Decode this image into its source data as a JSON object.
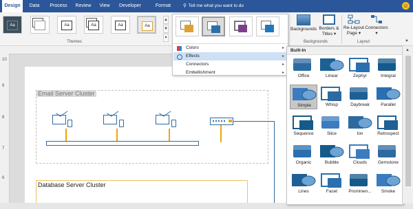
{
  "tabs": [
    "Design",
    "Data",
    "Process",
    "Review",
    "View",
    "Developer",
    "Format"
  ],
  "tell_me": "Tell me what you want to do",
  "ribbon": {
    "themes_label": "Themes",
    "backgrounds_group_label": "Backgrounds",
    "layout_group_label": "Layout",
    "backgrounds_button": "Backgrounds",
    "borders_button_line1": "Borders &",
    "borders_button_line2": "Titles",
    "relayout_button_line1": "Re-Layout",
    "relayout_button_line2": "Page",
    "connectors_button": "Connectors",
    "theme_thumb_text": "Aa"
  },
  "menu": {
    "items": [
      {
        "label": "Colors",
        "has_submenu": true,
        "highlighted": false
      },
      {
        "label": "Effects",
        "has_submenu": true,
        "highlighted": true
      },
      {
        "label": "Connectors",
        "has_submenu": true,
        "highlighted": false
      },
      {
        "label": "Embellishment",
        "has_submenu": true,
        "highlighted": false
      }
    ]
  },
  "gallery": {
    "header": "Built-In",
    "items": [
      "Office",
      "Linear",
      "Zephyr",
      "Integral",
      "Simple",
      "Whisp",
      "Daybreak",
      "Parallel",
      "Sequence",
      "Slice",
      "Ion",
      "Retrospect",
      "Organic",
      "Bubble",
      "Clouds",
      "Gemstone",
      "Lines",
      "Facet",
      "Prominen...",
      "Smoke"
    ],
    "selected": "Simple"
  },
  "canvas": {
    "email_cluster_title": "Email Server Cluster",
    "database_cluster_title": "Database Server Cluster"
  },
  "ruler_left_marks": [
    "10",
    "9",
    "8",
    "7",
    "6"
  ],
  "colors": {
    "ribbon_blue": "#2b579a",
    "shape_blue": "#2d6aa0",
    "connector_orange": "#f0a500",
    "highlight": "#cde0f5"
  }
}
